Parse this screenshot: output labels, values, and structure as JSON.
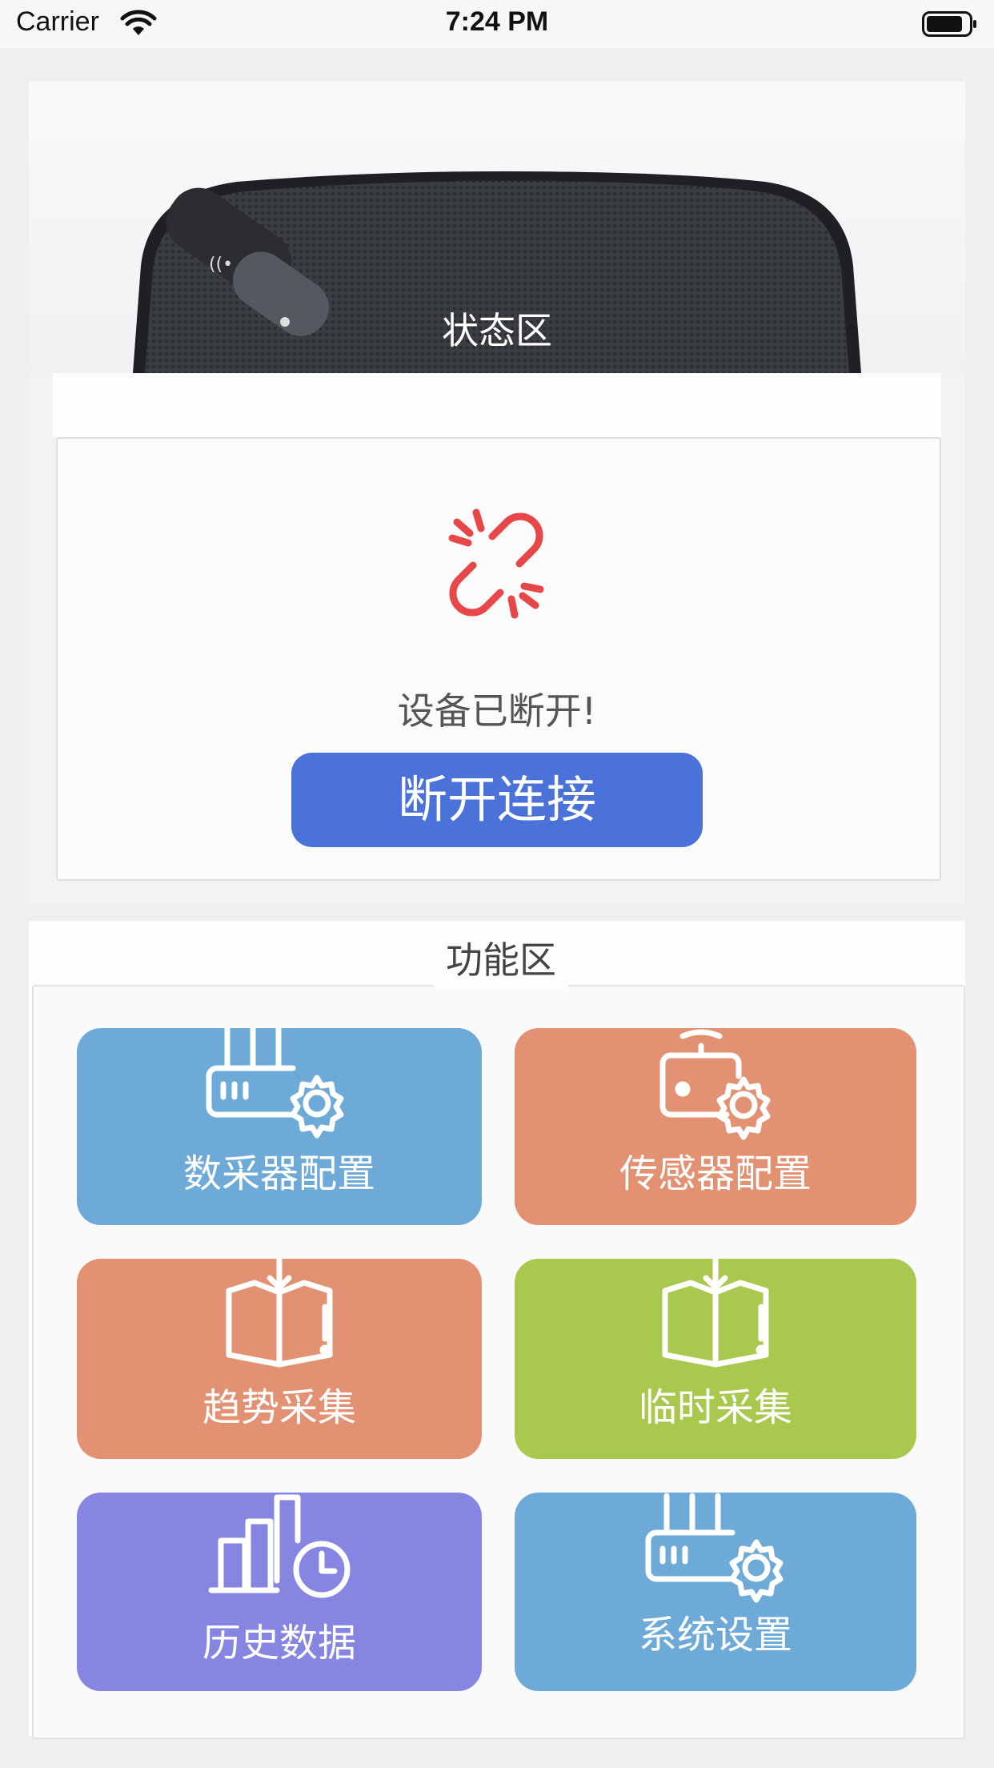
{
  "status_bar": {
    "carrier": "Carrier",
    "time": "7:24 PM"
  },
  "status_area": {
    "title": "状态区",
    "message": "设备已断开!",
    "button_label": "断开连接"
  },
  "function_area": {
    "title": "功能区",
    "tiles": [
      {
        "label": "数采器配置",
        "icon": "router-settings-icon",
        "color": "#6eaad7"
      },
      {
        "label": "传感器配置",
        "icon": "sensor-settings-icon",
        "color": "#e29273"
      },
      {
        "label": "趋势采集",
        "icon": "box-download-icon",
        "color": "#e29273"
      },
      {
        "label": "临时采集",
        "icon": "box-download-icon",
        "color": "#a8c84e"
      },
      {
        "label": "历史数据",
        "icon": "chart-clock-icon",
        "color": "#8686e2"
      },
      {
        "label": "系统设置",
        "icon": "router-settings-icon",
        "color": "#6eaad7"
      }
    ]
  },
  "colors": {
    "accent": "#4a72d8",
    "alert": "#e8474a"
  }
}
